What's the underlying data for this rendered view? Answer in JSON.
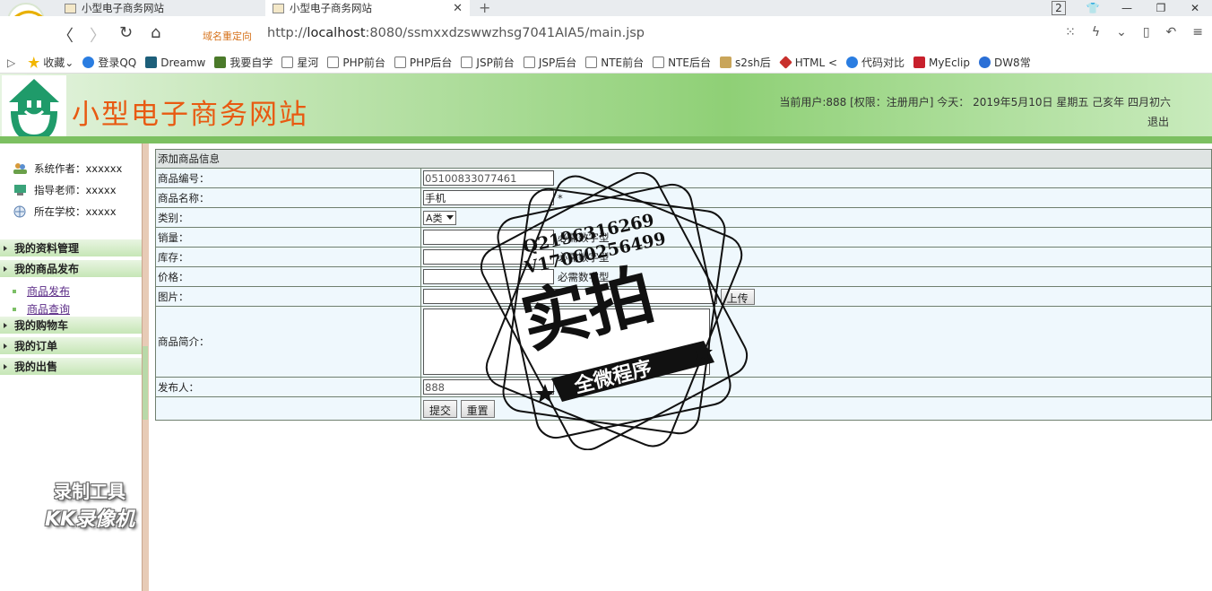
{
  "browser": {
    "tabs": [
      {
        "label": "小型电子商务网站",
        "active": false
      },
      {
        "label": "小型电子商务网站",
        "active": true
      }
    ],
    "tab_count": "2",
    "redirect_label": "域名重定向",
    "url_prefix": "http://",
    "url_host": "localhost",
    "url_rest": ":8080/ssmxxdzswwzhsg7041AIA5/main.jsp",
    "bookmarks": [
      {
        "label": "收藏",
        "icon": "star-icon",
        "color": "#f2b600"
      },
      {
        "label": "登录QQ",
        "icon": "qq-icon",
        "color": "#2a7de1"
      },
      {
        "label": "Dreamw",
        "icon": "dreamweaver-icon",
        "color": "#1d5f7a"
      },
      {
        "label": "我要自学",
        "icon": "leaf-icon",
        "color": "#4b7a2a"
      },
      {
        "label": "星河",
        "icon": "page-icon",
        "color": "#ffffff"
      },
      {
        "label": "PHP前台",
        "icon": "page-icon",
        "color": "#ffffff"
      },
      {
        "label": "PHP后台",
        "icon": "page-icon",
        "color": "#ffffff"
      },
      {
        "label": "JSP前台",
        "icon": "page-icon",
        "color": "#ffffff"
      },
      {
        "label": "JSP后台",
        "icon": "page-icon",
        "color": "#ffffff"
      },
      {
        "label": "NTE前台",
        "icon": "page-icon",
        "color": "#ffffff"
      },
      {
        "label": "NTE后台",
        "icon": "page-icon",
        "color": "#ffffff"
      },
      {
        "label": "s2sh后",
        "icon": "image-icon",
        "color": "#c9a55a"
      },
      {
        "label": "HTML <",
        "icon": "html-icon",
        "color": "#c8302c"
      },
      {
        "label": "代码对比",
        "icon": "compare-icon",
        "color": "#2a7de1"
      },
      {
        "label": "MyEclip",
        "icon": "myeclipse-icon",
        "color": "#c8202c"
      },
      {
        "label": "DW8常",
        "icon": "paw-icon",
        "color": "#2a6fd6"
      }
    ]
  },
  "header": {
    "site_title": "小型电子商务网站",
    "user_info": "当前用户:888 [权限：注册用户] 今天： 2019年5月10日 星期五 己亥年 四月初六",
    "logout": "退出"
  },
  "sidebar": {
    "info": [
      {
        "label": "系统作者：xxxxxx",
        "icon": "users-icon"
      },
      {
        "label": "指导老师：xxxxx",
        "icon": "teacher-icon"
      },
      {
        "label": "所在学校：xxxxx",
        "icon": "globe-icon"
      }
    ],
    "menu": [
      {
        "label": "我的资料管理"
      },
      {
        "label": "我的商品发布"
      },
      {
        "label": "我的购物车"
      },
      {
        "label": "我的订单"
      },
      {
        "label": "我的出售"
      }
    ],
    "sub_items": [
      {
        "label": "商品发布"
      },
      {
        "label": "商品查询"
      }
    ]
  },
  "form": {
    "title": "添加商品信息",
    "fields": {
      "code": {
        "label": "商品编号：",
        "value": "05100833077461"
      },
      "name": {
        "label": "商品名称：",
        "value": "手机",
        "required": "*"
      },
      "category": {
        "label": "类别：",
        "value": "A类"
      },
      "sales": {
        "label": "销量：",
        "value": "",
        "hint": "必需数字型"
      },
      "stock": {
        "label": "库存：",
        "value": "",
        "hint": "必需数字型"
      },
      "price": {
        "label": "价格：",
        "value": "",
        "hint": "必需数字型"
      },
      "image": {
        "label": "图片：",
        "value": "",
        "upload_button": "上传"
      },
      "intro": {
        "label": "商品简介：",
        "value": ""
      },
      "publisher": {
        "label": "发布人：",
        "value": "888"
      }
    },
    "submit": "提交",
    "reset": "重置"
  },
  "overlay": {
    "stamp_line1": "Q2196316269",
    "stamp_line2": "V17060256499",
    "stamp_main": "实拍",
    "stamp_banner": "全微程序",
    "recorder_line1": "录制工具",
    "recorder_line2": "KK录像机"
  }
}
